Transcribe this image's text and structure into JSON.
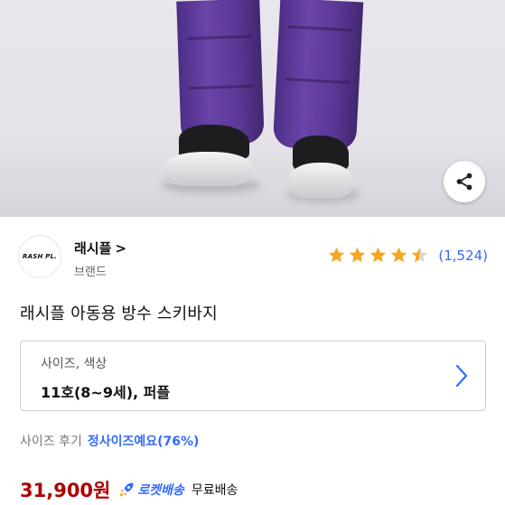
{
  "brand": {
    "logo_text": "RASH PL.",
    "name": "래시플",
    "chevron": ">",
    "sub_label": "브랜드"
  },
  "rating": {
    "stars": 4.5,
    "count": "(1,524)",
    "star_color": "#f5a623"
  },
  "product": {
    "title": "래시플 아동용 방수 스키바지"
  },
  "option": {
    "label": "사이즈, 색상",
    "value": "11호(8~9세), 퍼플"
  },
  "size_review": {
    "label": "사이즈 후기",
    "fit_text": "정사이즈예요(76%)"
  },
  "price": {
    "amount": "31,900원",
    "delivery_label": "로켓배송",
    "shipping": "무료배송",
    "price_color": "#ae0000",
    "accent_color": "#346aff"
  },
  "icons": {
    "share": "share-icon",
    "chevron_right": "chevron-right-icon",
    "rocket": "rocket-icon",
    "star": "star-icon"
  }
}
